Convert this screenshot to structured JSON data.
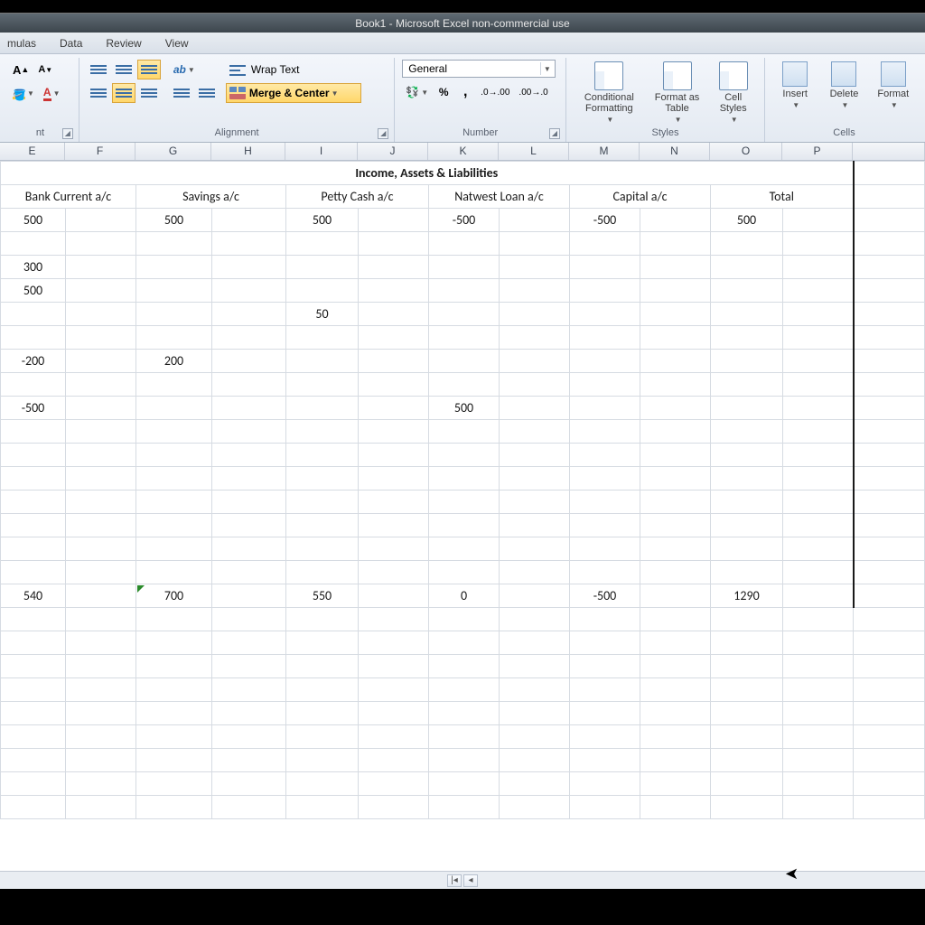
{
  "window": {
    "title": "Book1 - Microsoft Excel non-commercial use"
  },
  "tabs": {
    "formulas": "mulas",
    "data": "Data",
    "review": "Review",
    "view": "View"
  },
  "ribbon": {
    "font_group": "nt",
    "alignment_group": "Alignment",
    "number_group": "Number",
    "styles_group": "Styles",
    "cells_group": "Cells",
    "wrap_text": "Wrap Text",
    "merge_center": "Merge & Center",
    "number_format": "General",
    "cond_fmt": "Conditional Formatting",
    "fmt_table": "Format as Table",
    "cell_styles": "Cell Styles",
    "insert": "Insert",
    "delete": "Delete",
    "format": "Format"
  },
  "columns": [
    "E",
    "F",
    "G",
    "H",
    "I",
    "J",
    "K",
    "L",
    "M",
    "N",
    "O",
    "P",
    ""
  ],
  "sheet": {
    "section_title": "Income, Assets & Liabilities",
    "headers": {
      "bank": "Bank Current a/c",
      "savings": "Savings a/c",
      "petty": "Petty Cash a/c",
      "natwest": "Natwest Loan a/c",
      "capital": "Capital a/c",
      "total": "Total"
    },
    "r1": {
      "bank": "500",
      "savings": "500",
      "petty": "500",
      "natwest": "-500",
      "capital": "-500",
      "total": "500"
    },
    "r3": {
      "bank": "300"
    },
    "r4": {
      "bank": "500"
    },
    "r5": {
      "petty": "50"
    },
    "r7": {
      "bank": "-200",
      "savings": "200"
    },
    "r9": {
      "bank": "-500",
      "natwest": "500"
    },
    "totals": {
      "bank": "540",
      "savings": "700",
      "petty": "550",
      "natwest": "0",
      "capital": "-500",
      "total": "1290"
    }
  }
}
